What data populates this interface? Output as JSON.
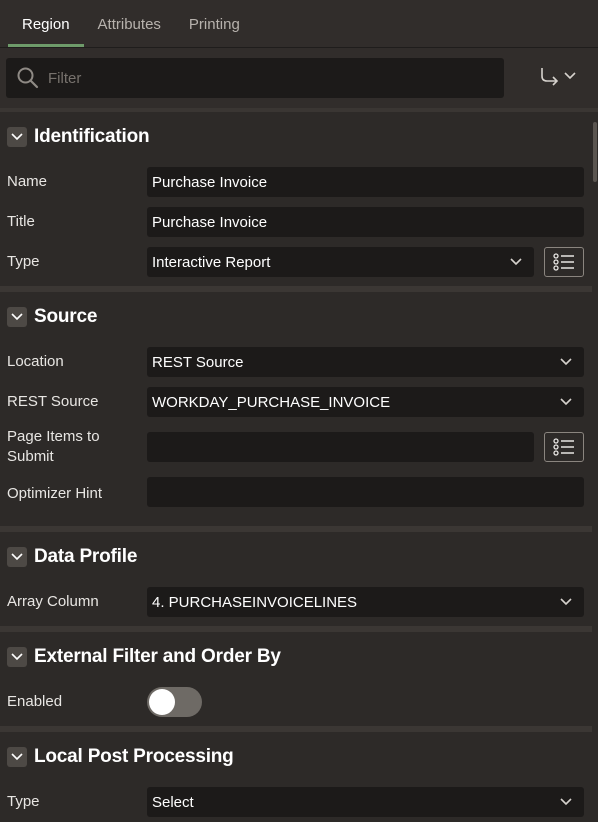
{
  "tabs": [
    {
      "label": "Region",
      "active": true
    },
    {
      "label": "Attributes",
      "active": false
    },
    {
      "label": "Printing",
      "active": false
    }
  ],
  "filter": {
    "placeholder": "Filter"
  },
  "sections": {
    "identification": {
      "title": "Identification",
      "name_label": "Name",
      "name_value": "Purchase Invoice",
      "title_label": "Title",
      "title_value": "Purchase Invoice",
      "type_label": "Type",
      "type_value": "Interactive Report"
    },
    "source": {
      "title": "Source",
      "location_label": "Location",
      "location_value": "REST Source",
      "rest_source_label": "REST Source",
      "rest_source_value": "WORKDAY_PURCHASE_INVOICE",
      "page_items_label": "Page Items to Submit",
      "page_items_value": "",
      "optimizer_label": "Optimizer Hint",
      "optimizer_value": ""
    },
    "data_profile": {
      "title": "Data Profile",
      "array_column_label": "Array Column",
      "array_column_value": "4. PURCHASEINVOICELINES"
    },
    "external_filter": {
      "title": "External Filter and Order By",
      "enabled_label": "Enabled",
      "enabled_value": false
    },
    "local_post": {
      "title": "Local Post Processing",
      "type_label": "Type",
      "type_value": "Select"
    }
  },
  "colors": {
    "background": "#2d2a28",
    "field": "#1c1a19",
    "active_tab_underline": "#6e9b6a"
  }
}
